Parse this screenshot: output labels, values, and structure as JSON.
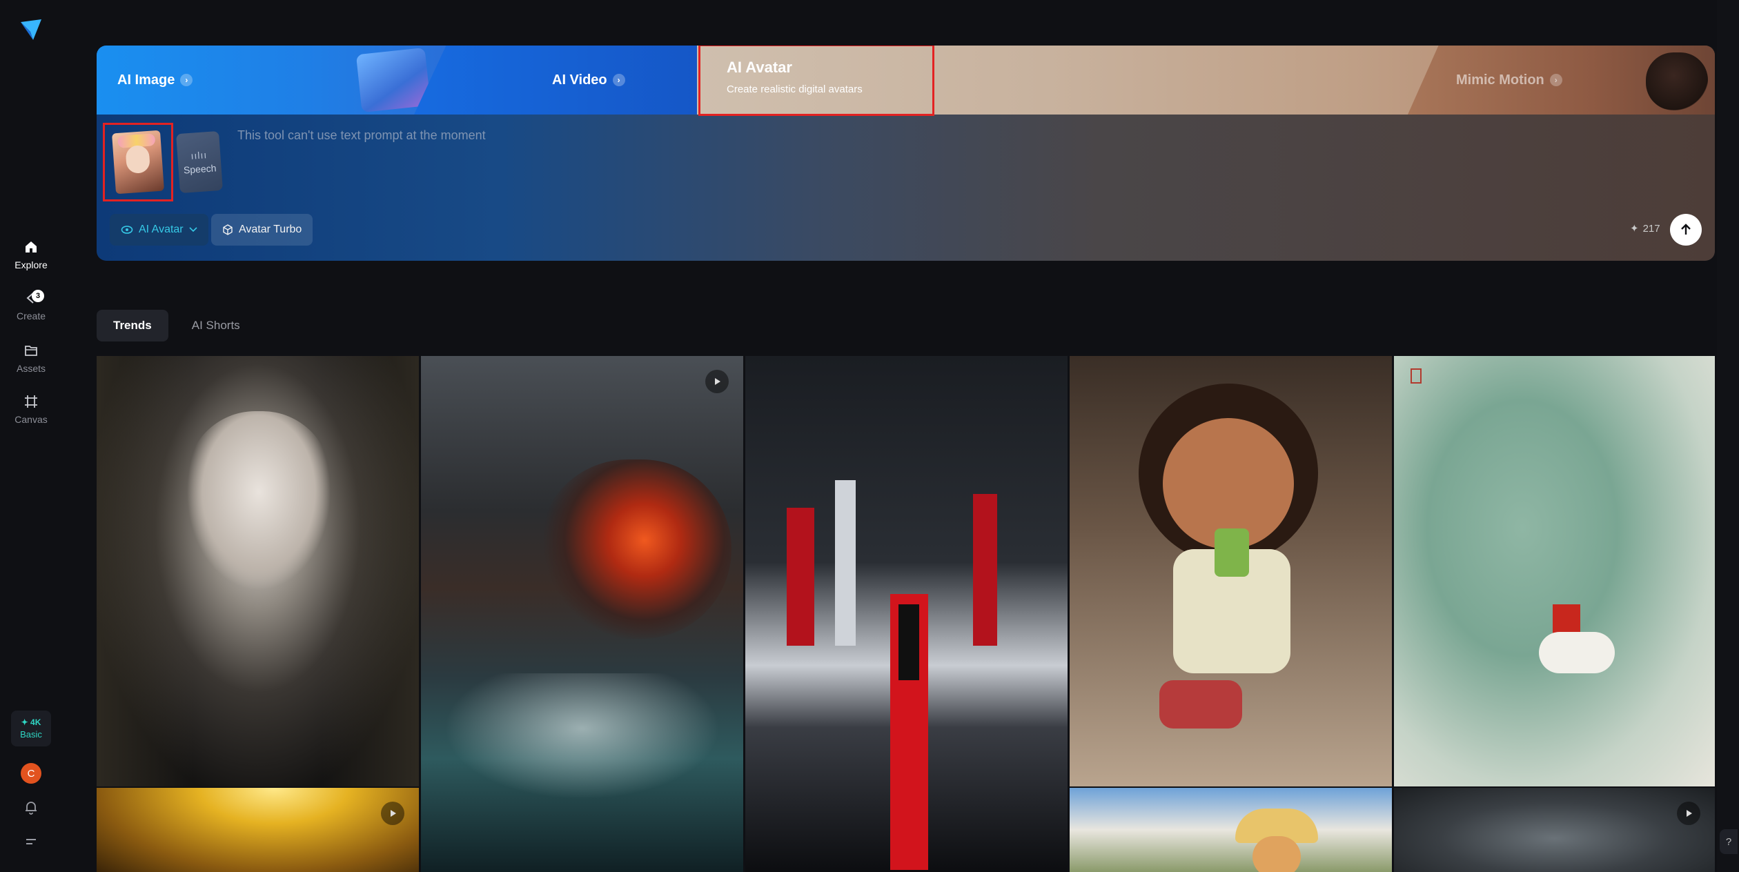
{
  "sidebar": {
    "nav": [
      {
        "label": "Explore",
        "icon": "home-icon",
        "active": true
      },
      {
        "label": "Create",
        "icon": "create-icon",
        "badge": "3"
      },
      {
        "label": "Assets",
        "icon": "folder-icon"
      },
      {
        "label": "Canvas",
        "icon": "canvas-icon"
      }
    ],
    "plan": {
      "credits": "4K",
      "tier": "Basic"
    },
    "avatar_initial": "C"
  },
  "tool_tabs": {
    "ai_image": "AI Image",
    "ai_video": "AI Video",
    "ai_avatar": {
      "title": "AI Avatar",
      "subtitle": "Create realistic digital avatars"
    },
    "mimic_motion": "Mimic Motion"
  },
  "prompt": {
    "placeholder": "This tool can't use text prompt at the moment",
    "speech_label": "Speech",
    "model_chip": "AI Avatar",
    "turbo_chip": "Avatar Turbo",
    "credit_cost": "217"
  },
  "feed": {
    "tabs": [
      "Trends",
      "AI Shorts"
    ],
    "active_tab": "Trends",
    "tiles": [
      {
        "subject": "veiled-portrait-man",
        "video": false
      },
      {
        "subject": "stormy-sea-explosion",
        "video": true
      },
      {
        "subject": "neon-city-figure",
        "video": false
      },
      {
        "subject": "cartoon-girl-drinking",
        "video": false
      },
      {
        "subject": "ink-painting-horse-rider",
        "video": false
      },
      {
        "subject": "golden-cave",
        "video": true
      },
      {
        "subject": "cat-in-hat",
        "video": false
      },
      {
        "subject": "storm-clouds",
        "video": true
      }
    ]
  },
  "colors": {
    "accent": "#2fd6c4",
    "highlight": "#e32222",
    "background": "#0f1014"
  }
}
